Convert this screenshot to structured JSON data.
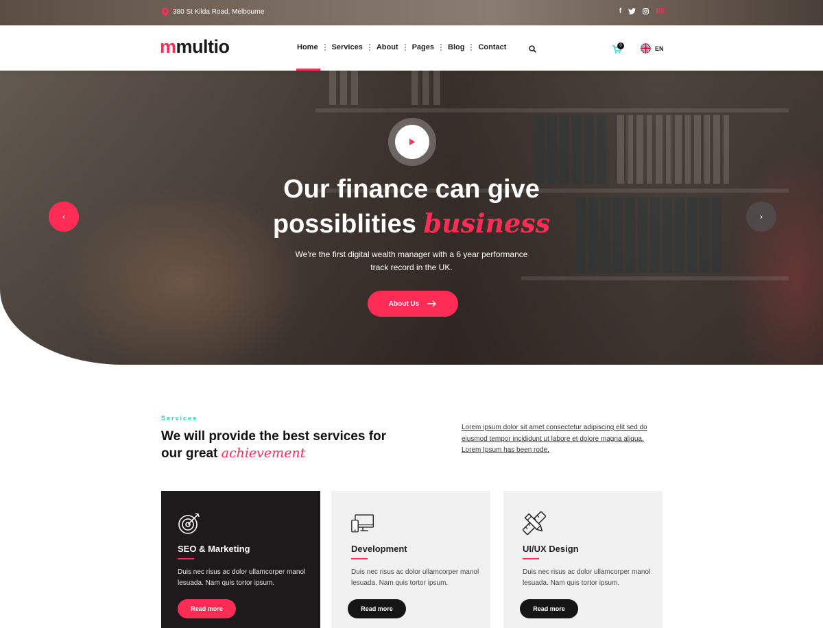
{
  "topbar": {
    "address": "380 St Kilda Road, Melbourne",
    "social": [
      {
        "label": "f",
        "icon": "facebook-icon"
      },
      {
        "label": "twitter",
        "icon": "twitter-icon"
      },
      {
        "label": "instagram",
        "icon": "instagram-icon"
      },
      {
        "label": "Bē",
        "icon": "behance-icon"
      }
    ]
  },
  "nav": {
    "logo_accent": "m",
    "logo_rest": "multio",
    "items": [
      "Home",
      "Services",
      "About",
      "Pages",
      "Blog",
      "Contact"
    ],
    "active_item": "Home",
    "cart_count": "0",
    "language": "EN"
  },
  "hero": {
    "title_line1": "Our finance can give",
    "title_line2": "possiblities",
    "title_accent": "business",
    "subtitle": "We're the first digital wealth manager with a 6 year performance track record in the UK.",
    "button": "About Us"
  },
  "services": {
    "kicker": "Services",
    "title": "We will provide the best services for our great",
    "title_accent": "achievement",
    "description": "Lorem ipsum dolor sit amet consectetur adipiscing elit sed do eiusmod tempor incididunt ut labore et dolore magna aliqua. Lorem Ipsum has been rode.",
    "cards": [
      {
        "name": "SEO & Marketing",
        "text": "Duis nec risus ac dolor ullamcorper manol lesuada. Nam quis tortor ipsum.",
        "button": "Read more",
        "icon": "target-icon"
      },
      {
        "name": "Development",
        "text": "Duis nec risus ac dolor ullamcorper manol lesuada. Nam quis tortor ipsum.",
        "button": "Read more",
        "icon": "devices-icon"
      },
      {
        "name": "UI/UX Design",
        "text": "Duis nec risus ac dolor ullamcorper manol lesuada. Nam quis tortor ipsum.",
        "button": "Read more",
        "icon": "pencil-ruler-icon"
      }
    ]
  },
  "colors": {
    "accent": "#ff2d55",
    "teal": "#21d4c7",
    "dark": "#1d1a1b"
  }
}
